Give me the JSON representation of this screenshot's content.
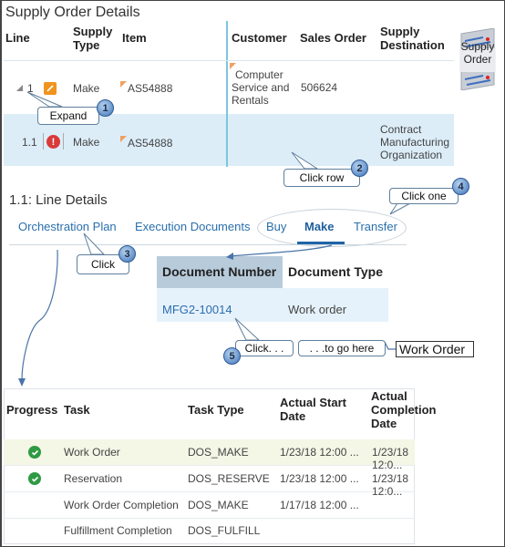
{
  "supply_order": {
    "title": "Supply Order Details",
    "headers": {
      "line": "Line",
      "supply_type": [
        "Supply",
        "Type"
      ],
      "item": "Item",
      "customer": "Customer",
      "sales_order": "Sales Order",
      "supply_destination": [
        "Supply",
        "Destination"
      ]
    },
    "rows": [
      {
        "line": "1",
        "supply_type": "Make",
        "item": "AS54888",
        "customer": [
          "Computer",
          "Service and",
          "Rentals"
        ],
        "sales_order": "506624",
        "supply_destination": [],
        "status_icon": "edit-icon"
      },
      {
        "line": "1.1",
        "supply_type": "Make",
        "item": "AS54888",
        "customer": [],
        "sales_order": "",
        "supply_destination": [
          "Contract",
          "Manufacturing",
          "Organization"
        ],
        "status_icon": "error-icon",
        "selected": true
      }
    ],
    "side_icon_label": [
      "Supply",
      "Order"
    ]
  },
  "line_details": {
    "title": "1.1: Line Details",
    "tabs": [
      {
        "label": "Orchestration Plan"
      },
      {
        "label": "Execution Documents"
      },
      {
        "label": "Buy"
      },
      {
        "label": "Make",
        "active": true
      },
      {
        "label": "Transfer"
      }
    ]
  },
  "documents": {
    "headers": [
      "Document Number",
      "Document Type"
    ],
    "rows": [
      {
        "number": "MFG2-10014",
        "type": "Work order"
      }
    ]
  },
  "orchestration": {
    "headers": {
      "progress": "Progress",
      "task": "Task",
      "task_type": "Task Type",
      "start": [
        "Actual Start",
        "Date"
      ],
      "completion": [
        "Actual",
        "Completion",
        "Date"
      ]
    },
    "rows": [
      {
        "done": true,
        "task": "Work Order",
        "type": "DOS_MAKE",
        "start": "1/23/18 12:00 ...",
        "completion": "1/23/18 12:0..."
      },
      {
        "done": true,
        "task": "Reservation",
        "type": "DOS_RESERVE",
        "start": "1/23/18 12:00 ...",
        "completion": "1/23/18 12:0..."
      },
      {
        "done": false,
        "task": "Work Order Completion",
        "type": "DOS_MAKE",
        "start": "1/17/18 12:00 ...",
        "completion": ""
      },
      {
        "done": false,
        "task": "Fulfillment Completion",
        "type": "DOS_FULFILL",
        "start": "",
        "completion": ""
      }
    ]
  },
  "callouts": [
    {
      "step": "1",
      "text": "Expand"
    },
    {
      "step": "2",
      "text": "Click row"
    },
    {
      "step": "3",
      "text": "Click"
    },
    {
      "step": "4",
      "text": "Click one"
    },
    {
      "step": "5",
      "text": "Click. . .",
      "text2": ". . .to go here",
      "target": "Work Order"
    }
  ],
  "colors": {
    "accent": "#2b6cb0",
    "selected_row": "#dcedf8",
    "edit": "#f0941e",
    "error": "#d93a3a",
    "success": "#2f9a44"
  }
}
